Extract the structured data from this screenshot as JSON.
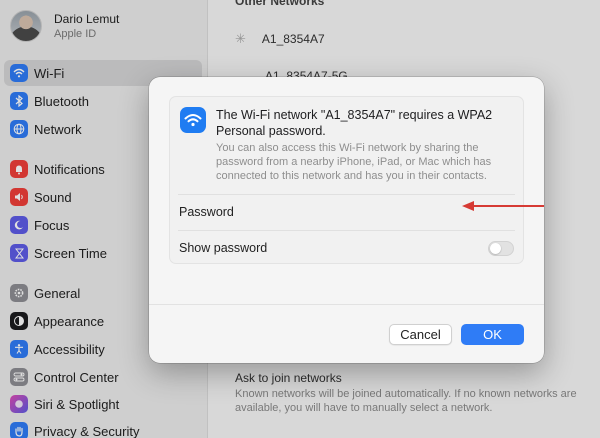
{
  "profile": {
    "name": "Dario Lemut",
    "subtitle": "Apple ID"
  },
  "sidebar": {
    "items": [
      {
        "label": "Wi-Fi",
        "icon": "wifi-icon",
        "color": "#2f7cf6",
        "selected": true
      },
      {
        "label": "Bluetooth",
        "icon": "bluetooth-icon",
        "color": "#2f7cf6"
      },
      {
        "label": "Network",
        "icon": "globe-icon",
        "color": "#2f7cf6"
      },
      {
        "label": "Notifications",
        "icon": "bell-icon",
        "color": "#ef3f3a"
      },
      {
        "label": "Sound",
        "icon": "speaker-icon",
        "color": "#ef3f3a"
      },
      {
        "label": "Focus",
        "icon": "moon-icon",
        "color": "#5e5ce6"
      },
      {
        "label": "Screen Time",
        "icon": "hourglass-icon",
        "color": "#5e5ce6"
      },
      {
        "label": "General",
        "icon": "gear-icon",
        "color": "#8e8e93"
      },
      {
        "label": "Appearance",
        "icon": "appearance-icon",
        "color": "#1c1c1e"
      },
      {
        "label": "Accessibility",
        "icon": "accessibility-icon",
        "color": "#2f7cf6"
      },
      {
        "label": "Control Center",
        "icon": "control-center-icon",
        "color": "#8e8e93"
      },
      {
        "label": "Siri & Spotlight",
        "icon": "siri-icon",
        "color": "#b14cd8"
      },
      {
        "label": "Privacy & Security",
        "icon": "hand-icon",
        "color": "#2f7cf6"
      }
    ]
  },
  "content": {
    "section_title": "Other Networks",
    "networks": [
      "A1_8354A7",
      "A1_8354A7-5G"
    ],
    "ask": {
      "title": "Ask to join networks",
      "description": "Known networks will be joined automatically. If no known networks are available, you will have to manually select a network."
    }
  },
  "dialog": {
    "title": "The Wi-Fi network \"A1_8354A7\" requires a WPA2 Personal password.",
    "body": "You can also access this Wi-Fi network by sharing the password from a nearby iPhone, iPad, or Mac which has connected to this network and has you in their contacts.",
    "password_label": "Password",
    "password_value": "",
    "show_password_label": "Show password",
    "show_password_on": false,
    "cancel_label": "Cancel",
    "ok_label": "OK",
    "accent_color": "#2f7cf6",
    "annotation_arrow_color": "#d63a34"
  }
}
